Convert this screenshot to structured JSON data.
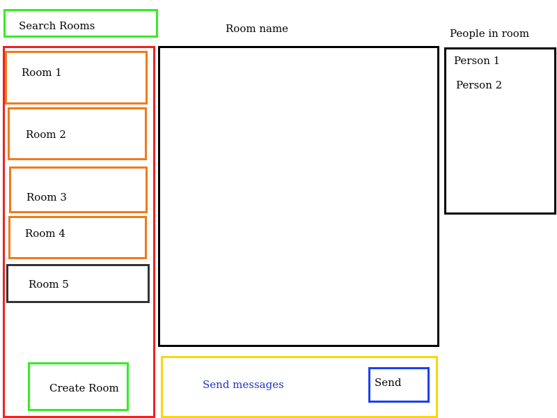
{
  "search": {
    "label": "Search Rooms"
  },
  "rooms": [
    {
      "label": "Room 1"
    },
    {
      "label": "Room 2"
    },
    {
      "label": "Room 3"
    },
    {
      "label": "Room 4"
    },
    {
      "label": "Room 5"
    }
  ],
  "create_room": {
    "label": "Create Room"
  },
  "chat": {
    "room_name": "Room name",
    "message_placeholder": "Send messages",
    "send_label": "Send"
  },
  "people": {
    "heading": "People in room",
    "list": [
      {
        "name": "Person 1"
      },
      {
        "name": "Person 2"
      }
    ]
  },
  "colors": {
    "search_border": "#33ee22",
    "room_panel_border": "#ee2222",
    "room_item_border": "#f07a1a",
    "selected_room_border": "#333333",
    "create_room_border": "#33ee22",
    "chat_border": "#000000",
    "message_bar_border": "#f5d90a",
    "message_text": "#2233cc",
    "send_border": "#1a3ff0",
    "people_border": "#000000"
  }
}
